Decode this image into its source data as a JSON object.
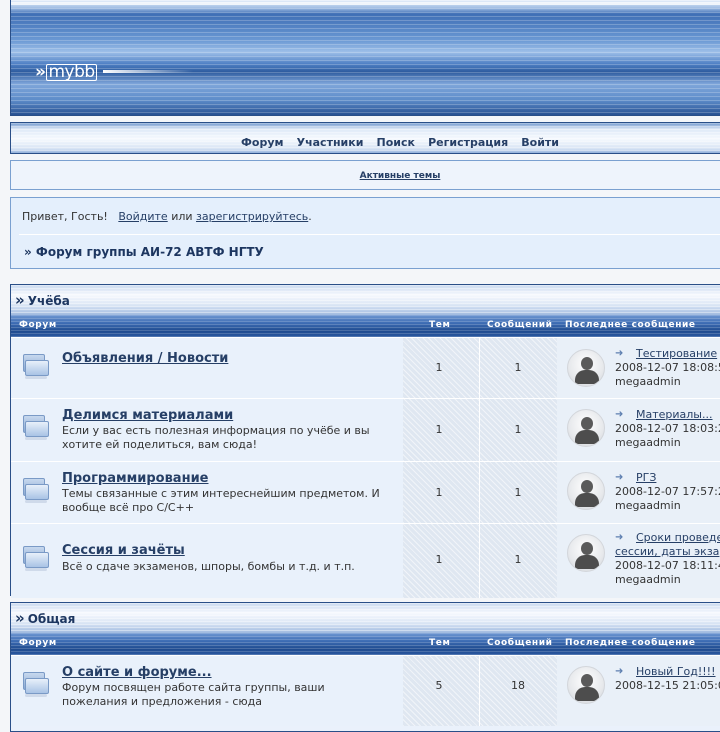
{
  "header": {
    "logo_arrows": "»",
    "logo_text": "mybb"
  },
  "menu": {
    "items": [
      "Форум",
      "Участники",
      "Поиск",
      "Регистрация",
      "Войти"
    ]
  },
  "active_topics": "Активные темы",
  "welcome": {
    "greeting": "Привет, Гость!",
    "login": "Войдите",
    "or": "или",
    "register": "зарегистрируйтесь",
    "period": ".",
    "crumb": "» Форум группы АИ-72 АВТФ НГТУ"
  },
  "columns": {
    "forum": "Форум",
    "topics": "Тем",
    "posts": "Сообщений",
    "last": "Последнее сообщение"
  },
  "categories": [
    {
      "title": "Учёба",
      "forums": [
        {
          "name": "Объявления / Новости",
          "desc": "",
          "topics": "1",
          "posts": "1",
          "last_title": "Тестирование",
          "last_date": "2008-12-07 18:08:5",
          "last_user": "megaadmin"
        },
        {
          "name": "Делимся материалами",
          "desc": "Если у вас есть полезная информация по учёбе и вы хотите ей поделиться, вам сюда!",
          "topics": "1",
          "posts": "1",
          "last_title": "Материалы...",
          "last_date": "2008-12-07 18:03:2",
          "last_user": "megaadmin"
        },
        {
          "name": "Программирование",
          "desc": "Темы связанные с этим интереснейшим предметом. И вообще всё про C/C++",
          "topics": "1",
          "posts": "1",
          "last_title": "РГЗ",
          "last_date": "2008-12-07 17:57:2",
          "last_user": "megaadmin"
        },
        {
          "name": "Сессия и зачёты",
          "desc": "Всё о сдаче экзаменов, шпоры, бомбы и т.д. и т.п.",
          "topics": "1",
          "posts": "1",
          "last_title": "Сроки проведе",
          "last_title2": "сессии, даты экза",
          "last_date": "2008-12-07 18:11:4",
          "last_user": "megaadmin"
        }
      ]
    },
    {
      "title": "Общая",
      "forums": [
        {
          "name": "О сайте и форуме...",
          "desc": "Форум посвящен работе сайта группы, ваши пожелания и предложения - сюда",
          "topics": "5",
          "posts": "18",
          "last_title": "Новый Год!!!!",
          "last_date": "2008-12-15 21:05:0",
          "last_user": ""
        }
      ]
    }
  ]
}
